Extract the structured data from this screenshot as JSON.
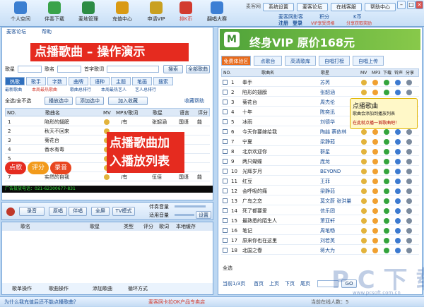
{
  "toolbar": {
    "items": [
      {
        "label": "个人空间",
        "icon": "microphone-icon",
        "color": "#3b7fd1"
      },
      {
        "label": "伴奏下载",
        "icon": "download-icon",
        "color": "#3aa34a"
      },
      {
        "label": "麦地管理",
        "icon": "book-icon",
        "color": "#2c8c45"
      },
      {
        "label": "充值中心",
        "icon": "coins-icon",
        "color": "#d99a14"
      },
      {
        "label": "申请VIP",
        "icon": "crown-icon",
        "color": "#c9a020"
      },
      {
        "label": "排K币",
        "icon": "gift-icon",
        "color": "#d23b2f"
      },
      {
        "label": "翻唱大赛",
        "icon": "trophy-icon",
        "color": "#3d7fd4"
      }
    ],
    "app_name": "麦客网",
    "top_links": [
      "系统设置",
      "麦客论坛",
      "在线客服",
      "帮助中心"
    ],
    "user_row": {
      "site": "麦客网影客",
      "points_label": "积分",
      "kb_label": "K币",
      "register": "注册",
      "login": "登录",
      "vip_note": "VIP享受资格",
      "k_note": "分享获取奖励"
    }
  },
  "left": {
    "subnav": [
      "麦客论坛",
      "帮助"
    ],
    "overlay_title": "点播歌曲 – 操作演示",
    "search": {
      "song_label": "歌星",
      "name_label": "歌名",
      "initial_label": "首字歌词",
      "search_btn": "搜索",
      "all_btn": "全部歌曲"
    },
    "tabs": [
      "热歌",
      "歌手",
      "字数",
      "曲牌",
      "语种",
      "主题",
      "笔画",
      "搜索"
    ],
    "subtabs": [
      "最新歌曲",
      "本周最热歌曲",
      "歌曲总排行",
      "本周最热艺人",
      "艺人总排行"
    ],
    "actions": {
      "select_all": "全选/全不选",
      "add_selected": "播放选中",
      "add_list": "添加选中",
      "collect_label": "加入收藏",
      "collect_help": "收藏帮助"
    },
    "columns": [
      "NO.",
      "歌曲名",
      "MV",
      "MP3/歌词",
      "歌星",
      "语言",
      "评分"
    ],
    "rows": [
      {
        "no": "1",
        "name": "陷形的翅膀",
        "mp3": "/有",
        "singer": "张韶涵",
        "lang": "国语",
        "rate": "能"
      },
      {
        "no": "2",
        "name": "秋天不回来",
        "mp3": "",
        "singer": "",
        "lang": "",
        "rate": ""
      },
      {
        "no": "3",
        "name": "菊花台",
        "mp3": "",
        "singer": "",
        "lang": "",
        "rate": ""
      },
      {
        "no": "4",
        "name": "香水有毒",
        "mp3": "",
        "singer": "",
        "lang": "",
        "rate": ""
      },
      {
        "no": "5",
        "name": "",
        "mp3": "",
        "singer": "",
        "lang": "",
        "rate": ""
      },
      {
        "no": "6",
        "name": "",
        "mp3": "",
        "singer": "",
        "lang": "",
        "rate": ""
      },
      {
        "no": "7",
        "name": "实然的自我",
        "mp3": "/有",
        "singer": "伍佰",
        "lang": "国语",
        "rate": "能"
      }
    ],
    "overlay_callout": "点播歌曲加\n入播放列表",
    "badges": [
      "点歌",
      "评分",
      "录音"
    ],
    "ticker": "厂告投放电话：021-62300677-831"
  },
  "player": {
    "record_btn": "录音",
    "mode_labels": [
      "原唱",
      "伴唱"
    ],
    "full_btn": "全屏",
    "tv_btn": "TV模式",
    "volume_label": "伴奏音量",
    "pitch_label": "适用音量",
    "tune_btn": "设置",
    "pl_columns": [
      "歌名",
      "歌星",
      "类型",
      "评分",
      "歌词",
      "本地缓存"
    ],
    "bottom_tools": [
      "歌单操作",
      "歌曲操作",
      "添加歌曲",
      "循环方式"
    ]
  },
  "right": {
    "banner_text": "终身VIP 原价168元",
    "banner_logo": "M",
    "tabs": [
      "免费体验区",
      "点歌台",
      "高清歌库",
      "自唱打榜",
      "自唱上传"
    ],
    "columns": [
      "NO.",
      "歌曲名",
      "歌星",
      "MV",
      "MP3",
      "下载",
      "铃声",
      "分享"
    ],
    "rows": [
      {
        "no": "1",
        "name": "奉手",
        "singer": "苏芮"
      },
      {
        "no": "2",
        "name": "陷形的翅膀",
        "singer": "张韶涵"
      },
      {
        "no": "3",
        "name": "菊花台",
        "singer": "周杰伦"
      },
      {
        "no": "4",
        "name": "十年",
        "singer": "陈奕迅"
      },
      {
        "no": "5",
        "name": "冰雨",
        "singer": "刘德华"
      },
      {
        "no": "6",
        "name": "今天你要嫁给我",
        "singer": "陶喆 蔡依林"
      },
      {
        "no": "7",
        "name": "宁夏",
        "singer": "梁静茹"
      },
      {
        "no": "8",
        "name": "北京欢迎你",
        "singer": "群星"
      },
      {
        "no": "9",
        "name": "两只蝴蝶",
        "singer": "庞龙"
      },
      {
        "no": "10",
        "name": "光辉岁月",
        "singer": "BEYOND"
      },
      {
        "no": "11",
        "name": "红豆",
        "singer": "王菲"
      },
      {
        "no": "12",
        "name": "会呼吸的痛",
        "singer": "梁静茹"
      },
      {
        "no": "13",
        "name": "广岛之恋",
        "singer": "莫文蔚 张洪量"
      },
      {
        "no": "14",
        "name": "死了都要爱",
        "singer": "信乐团"
      },
      {
        "no": "15",
        "name": "最熟悉的陌生人",
        "singer": "萧亚轩"
      },
      {
        "no": "16",
        "name": "笔记",
        "singer": "周笔畅"
      },
      {
        "no": "17",
        "name": "原来你也在这里",
        "singer": "刘若英"
      },
      {
        "no": "18",
        "name": "北国之春",
        "singer": "蒋大为"
      }
    ],
    "tooltip": {
      "title": "点播歌曲",
      "line1": "歌曲会添加到播放列表",
      "line2": "在此就点播一首歌曲吧！"
    },
    "select_all": "全选",
    "pager": {
      "info": "当前1/3页",
      "first": "首页",
      "prev": "上页",
      "next": "下页",
      "last": "尾页",
      "go": "GO"
    }
  },
  "status": {
    "left": "为什么我充值后还不能点播歌曲？",
    "center": "麦客网卡拉OK产品专卖店",
    "right": "当前在线人数：5"
  },
  "watermark": {
    "big": "P C 下 载 网",
    "url": "www.pcsoft.com.cn"
  }
}
